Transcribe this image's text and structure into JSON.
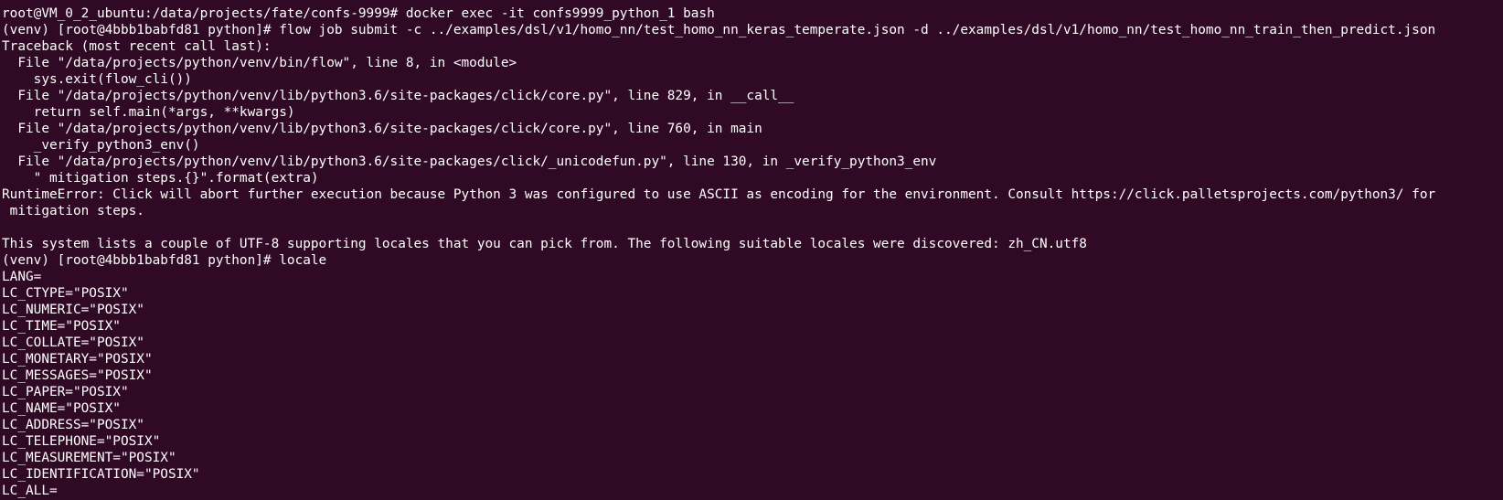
{
  "terminal": {
    "lines": [
      "root@VM_0_2_ubuntu:/data/projects/fate/confs-9999# docker exec -it confs9999_python_1 bash",
      "(venv) [root@4bbb1babfd81 python]# flow job submit -c ../examples/dsl/v1/homo_nn/test_homo_nn_keras_temperate.json -d ../examples/dsl/v1/homo_nn/test_homo_nn_train_then_predict.json",
      "Traceback (most recent call last):",
      "  File \"/data/projects/python/venv/bin/flow\", line 8, in <module>",
      "    sys.exit(flow_cli())",
      "  File \"/data/projects/python/venv/lib/python3.6/site-packages/click/core.py\", line 829, in __call__",
      "    return self.main(*args, **kwargs)",
      "  File \"/data/projects/python/venv/lib/python3.6/site-packages/click/core.py\", line 760, in main",
      "    _verify_python3_env()",
      "  File \"/data/projects/python/venv/lib/python3.6/site-packages/click/_unicodefun.py\", line 130, in _verify_python3_env",
      "    \" mitigation steps.{}\".format(extra)",
      "RuntimeError: Click will abort further execution because Python 3 was configured to use ASCII as encoding for the environment. Consult https://click.palletsprojects.com/python3/ for",
      " mitigation steps.",
      "",
      "This system lists a couple of UTF-8 supporting locales that you can pick from. The following suitable locales were discovered: zh_CN.utf8",
      "(venv) [root@4bbb1babfd81 python]# locale",
      "LANG=",
      "LC_CTYPE=\"POSIX\"",
      "LC_NUMERIC=\"POSIX\"",
      "LC_TIME=\"POSIX\"",
      "LC_COLLATE=\"POSIX\"",
      "LC_MONETARY=\"POSIX\"",
      "LC_MESSAGES=\"POSIX\"",
      "LC_PAPER=\"POSIX\"",
      "LC_NAME=\"POSIX\"",
      "LC_ADDRESS=\"POSIX\"",
      "LC_TELEPHONE=\"POSIX\"",
      "LC_MEASUREMENT=\"POSIX\"",
      "LC_IDENTIFICATION=\"POSIX\"",
      "LC_ALL="
    ],
    "background_color": "#300a24",
    "text_color": "#ffffff"
  }
}
